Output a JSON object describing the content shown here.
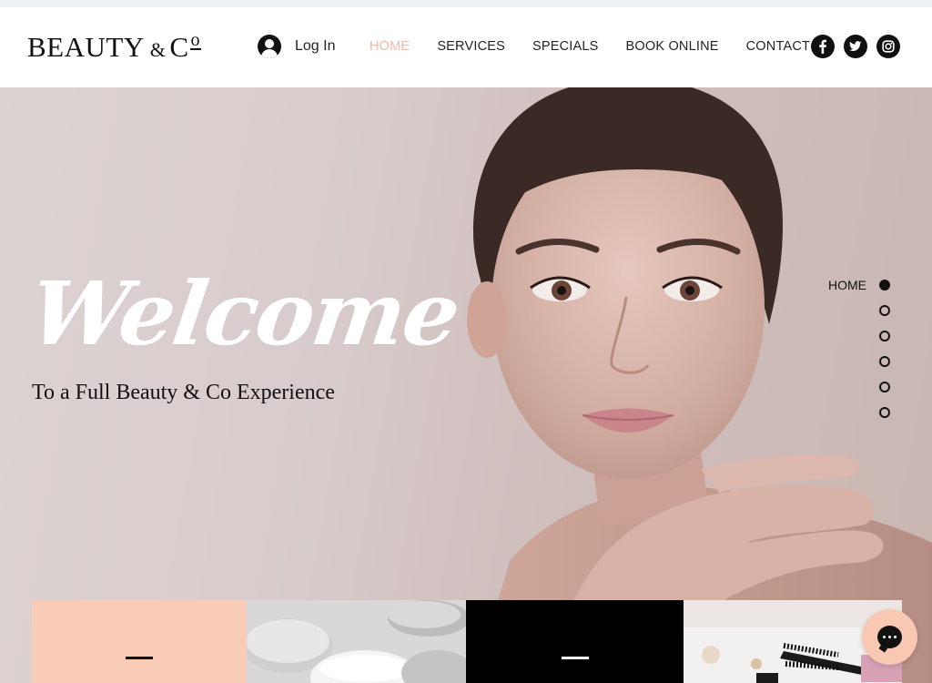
{
  "header": {
    "logo": {
      "main": "BEAUTY",
      "amp": "&",
      "c": "C",
      "o": "o"
    },
    "login_label": "Log In",
    "nav": [
      {
        "label": "HOME",
        "active": true
      },
      {
        "label": "SERVICES",
        "active": false
      },
      {
        "label": "SPECIALS",
        "active": false
      },
      {
        "label": "BOOK ONLINE",
        "active": false
      },
      {
        "label": "CONTACT",
        "active": false
      }
    ],
    "social": [
      "facebook-icon",
      "twitter-icon",
      "instagram-icon"
    ]
  },
  "hero": {
    "title": "Welcome",
    "subtitle": "To a Full Beauty & Co Experience",
    "section_nav": {
      "active_label": "HOME",
      "count": 6,
      "active_index": 0
    }
  },
  "tiles": [
    {
      "kind": "peach",
      "color": "#f9ccb8"
    },
    {
      "kind": "stones-image"
    },
    {
      "kind": "black",
      "color": "#000000"
    },
    {
      "kind": "makeup-image"
    }
  ],
  "colors": {
    "accent": "#f0b9a1",
    "peach": "#f9ccb8",
    "text": "#111111"
  },
  "chat": {
    "icon": "chat-bubble-icon"
  }
}
